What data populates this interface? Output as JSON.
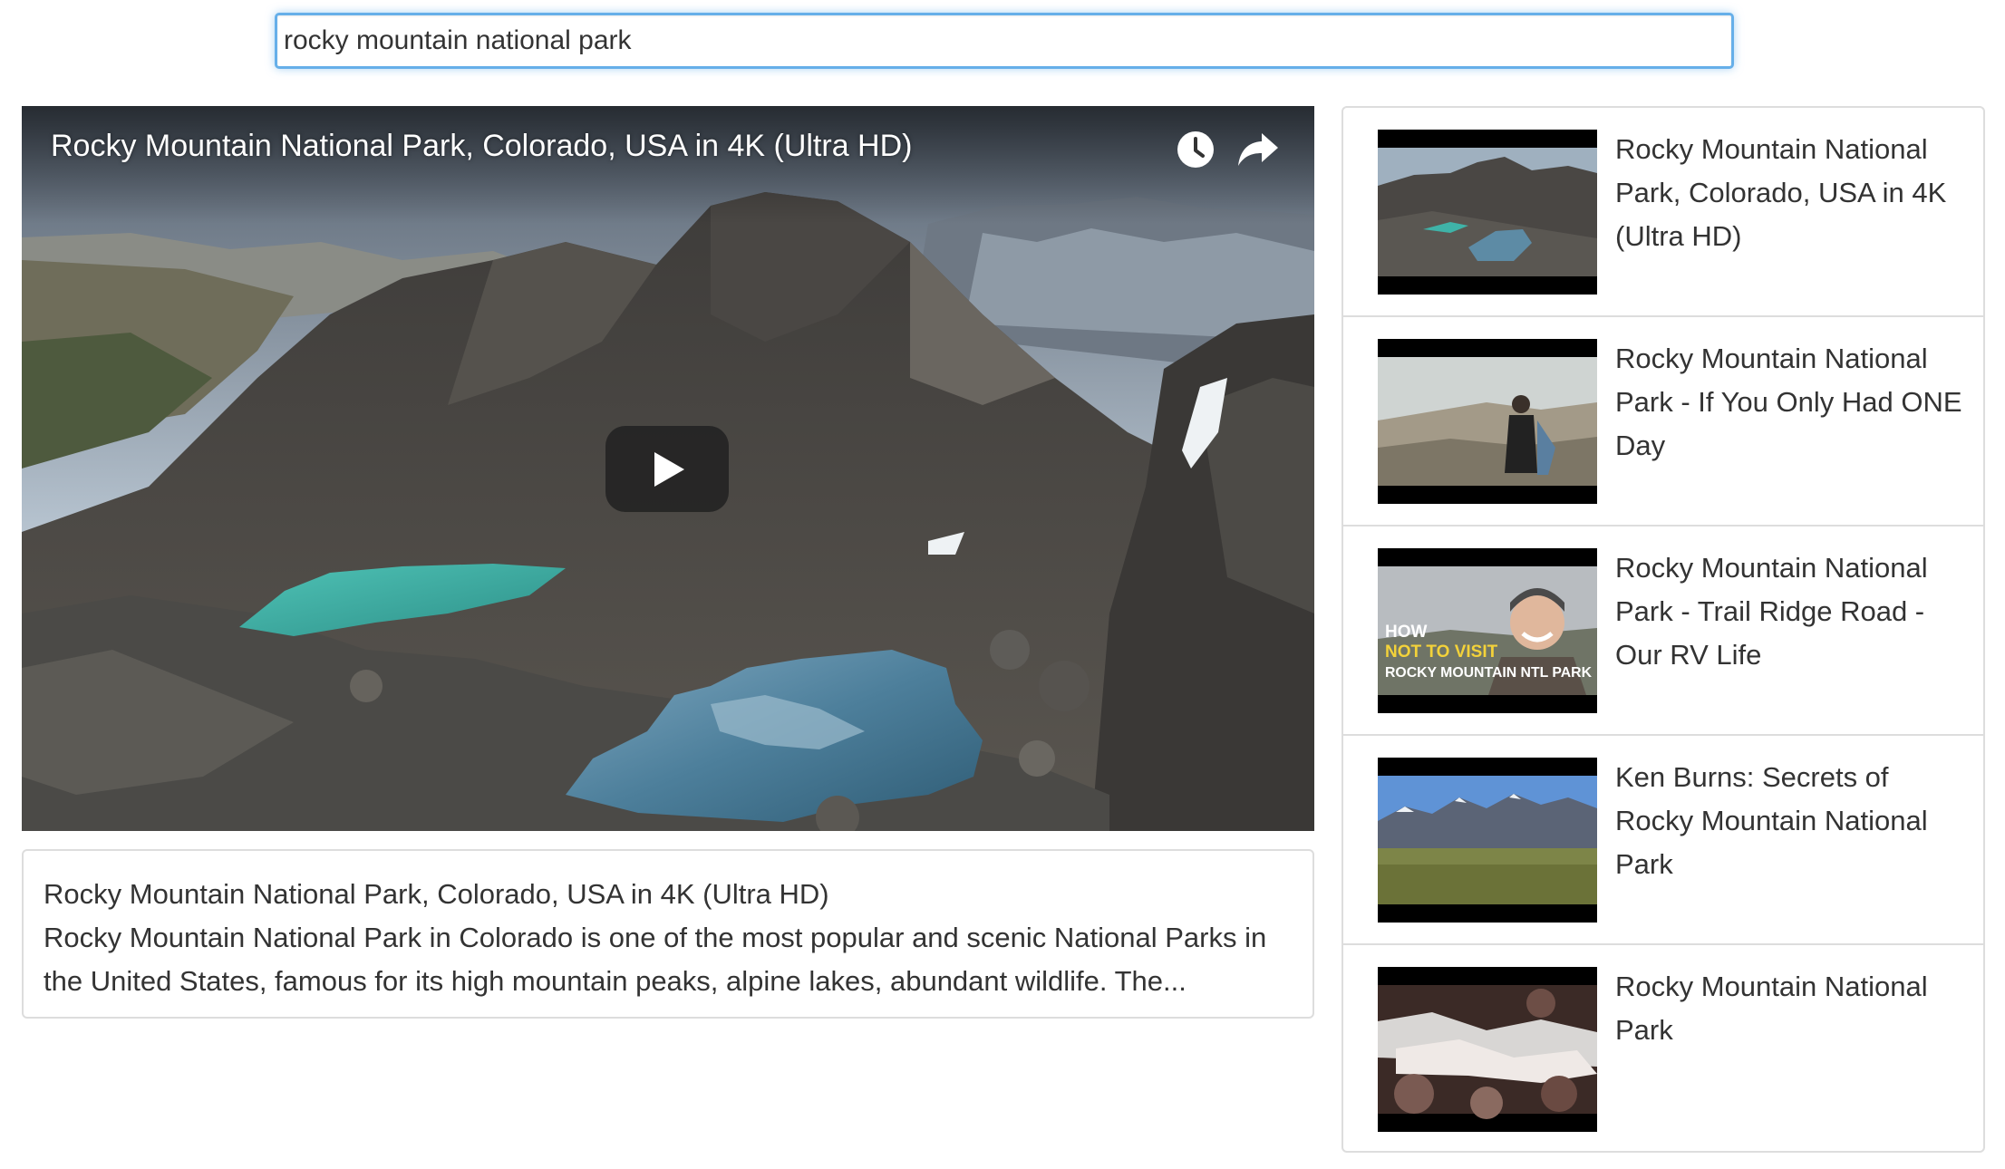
{
  "search": {
    "query": "rocky mountain national park"
  },
  "player": {
    "title": "Rocky Mountain National Park, Colorado, USA in 4K (Ultra HD)",
    "icons": {
      "watch_later": "clock-icon",
      "share": "share-arrow-icon",
      "play": "play-icon"
    }
  },
  "description": {
    "title": "Rocky Mountain National Park, Colorado, USA in 4K (Ultra HD)",
    "text": "Rocky Mountain National Park in Colorado is one of the most popular and scenic National Parks in the United States, famous for its high mountain peaks, alpine lakes, abundant wildlife. The..."
  },
  "sidebar": {
    "items": [
      {
        "title": "Rocky Mountain National Park, Colorado, USA in 4K (Ultra HD)"
      },
      {
        "title": "Rocky Mountain National Park - If You Only Had ONE Day"
      },
      {
        "title": "Rocky Mountain National Park - Trail Ridge Road - Our RV Life",
        "thumb_text": [
          "HOW",
          "NOT TO VISIT",
          "ROCKY MOUNTAIN NTL PARK"
        ]
      },
      {
        "title": "Ken Burns: Secrets of Rocky Mountain National Park"
      },
      {
        "title": "Rocky Mountain National Park"
      }
    ]
  },
  "colors": {
    "focus_border": "#66afe9",
    "panel_border": "#dddddd",
    "text": "#333333",
    "lake": "#3fb3a8"
  }
}
